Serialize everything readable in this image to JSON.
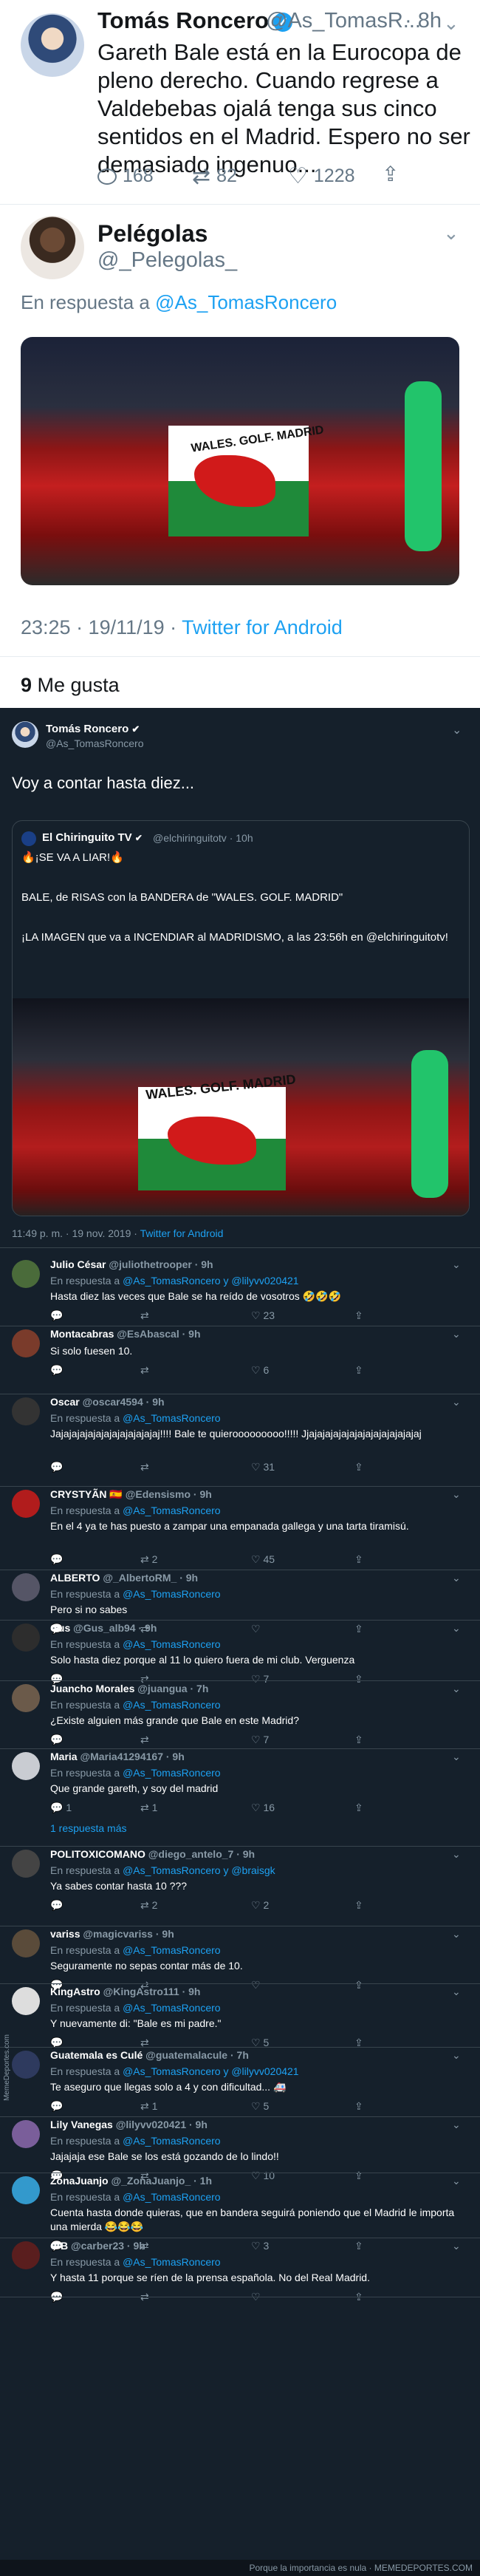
{
  "tweet1": {
    "name": "Tomás Roncero",
    "handle": "@As_TomasR...",
    "time": "· 8h",
    "text": "Gareth Bale está en la Eurocopa de pleno derecho. Cuando regrese a Valdebebas ojalá tenga sus cinco sentidos en el Madrid. Espero no ser demasiado ingenuo...",
    "replies": "168",
    "retweets": "82",
    "likes": "1228"
  },
  "tweet2": {
    "name": "Pelégolas",
    "handle": "@_Pelegolas_",
    "reply_prefix": "En respuesta a ",
    "reply_to": "@As_TomasRoncero",
    "photo_text": "WALES. GOLF. MADRID",
    "time": "23:25 · 19/11/19 · ",
    "source": "Twitter for Android",
    "likes_count": "9",
    "likes_label": " Me gusta"
  },
  "dark": {
    "main": {
      "name": "Tomás Roncero",
      "handle": "@As_TomasRoncero",
      "text": "Voy a contar hasta diez...",
      "quote": {
        "name": "El Chiringuito TV",
        "handle": "@elchiringuitotv · 10h",
        "line1": "🔥¡SE VA A LIAR!🔥",
        "line2": "BALE, de RISAS con la BANDERA de \"WALES. GOLF. MADRID\"",
        "line3": "¡LA IMAGEN que va a INCENDIAR al MADRIDISMO, a las 23:56h en @elchiringuitotv!",
        "photo_text": "WALES. GOLF. MADRID"
      },
      "meta": "11:49 p. m. · 19 nov. 2019 · ",
      "source": "Twitter for Android"
    },
    "replies": [
      {
        "name": "Julio César",
        "handle": "@juliothetrooper · 9h",
        "reply": "En respuesta a ",
        "reply_to": "@As_TomasRoncero y @lilyvv020421",
        "text": "Hasta diez las veces que Bale se ha reído de vosotros 🤣🤣🤣",
        "r": "",
        "rt": "",
        "l": "23"
      },
      {
        "name": "Montacabras",
        "handle": "@EsAbascal · 9h",
        "reply": "",
        "reply_to": "",
        "text": "Si solo fuesen 10.",
        "r": "",
        "rt": "",
        "l": "6"
      },
      {
        "name": "Oscar",
        "handle": "@oscar4594 · 9h",
        "reply": "En respuesta a ",
        "reply_to": "@As_TomasRoncero",
        "text": "Jajajajajajajajajajajajajaj!!!! Bale te quierooooooooo!!!!! Jjajajajajajajajajajajajajajaj",
        "r": "",
        "rt": "",
        "l": "31"
      },
      {
        "name": "CRYSTYÃN 🇪🇸",
        "handle": "@Edensismo · 9h",
        "reply": "En respuesta a ",
        "reply_to": "@As_TomasRoncero",
        "text": "En el 4 ya te has puesto a zampar una empanada gallega y una tarta tiramisú.",
        "r": "",
        "rt": "2",
        "l": "45"
      },
      {
        "name": "ALBERTO",
        "handle": "@_AlbertoRM_ · 9h",
        "reply": "En respuesta a ",
        "reply_to": "@As_TomasRoncero",
        "text": "Pero si no sabes",
        "r": "",
        "rt": "",
        "l": ""
      },
      {
        "name": "Gus",
        "handle": "@Gus_alb94 · 9h",
        "reply": "En respuesta a ",
        "reply_to": "@As_TomasRoncero",
        "text": "Solo hasta diez porque al 11 lo quiero fuera de mi club. Verguenza",
        "r": "",
        "rt": "",
        "l": "7"
      },
      {
        "name": "Juancho Morales",
        "handle": "@juangua · 7h",
        "reply": "En respuesta a ",
        "reply_to": "@As_TomasRoncero",
        "text": "¿Existe alguien más grande que Bale en este Madrid?",
        "r": "",
        "rt": "",
        "l": "7"
      },
      {
        "name": "Maria",
        "handle": "@Maria41294167 · 9h",
        "reply": "En respuesta a ",
        "reply_to": "@As_TomasRoncero",
        "text": "Que grande gareth, y soy del madrid",
        "r": "1",
        "rt": "1",
        "l": "16",
        "more": "1 respuesta más"
      },
      {
        "name": "POLITOXICOMANO",
        "handle": "@diego_antelo_7 · 9h",
        "reply": "En respuesta a ",
        "reply_to": "@As_TomasRoncero y @braisgk",
        "text": "Ya sabes contar hasta 10 ???",
        "r": "",
        "rt": "2",
        "l": "2"
      },
      {
        "name": "variss",
        "handle": "@magicvariss · 9h",
        "reply": "En respuesta a ",
        "reply_to": "@As_TomasRoncero",
        "text": "Seguramente no sepas contar más de 10.",
        "r": "",
        "rt": "",
        "l": ""
      },
      {
        "name": "KingAstro",
        "handle": "@KingAstro111 · 9h",
        "reply": "En respuesta a ",
        "reply_to": "@As_TomasRoncero",
        "text": "Y nuevamente di: \"Bale es mi padre.\"",
        "r": "",
        "rt": "",
        "l": "5"
      },
      {
        "name": "Guatemala es Culé",
        "handle": "@guatemalacule · 7h",
        "reply": "En respuesta a ",
        "reply_to": "@As_TomasRoncero y @lilyvv020421",
        "text": "Te aseguro que llegas solo a 4 y con dificultad... 🚑",
        "r": "",
        "rt": "1",
        "l": "5"
      },
      {
        "name": "Lily Vanegas",
        "handle": "@lilyvv020421 · 9h",
        "reply": "En respuesta a ",
        "reply_to": "@As_TomasRoncero",
        "text": "Jajajaja ese Bale se los está gozando de lo lindo!!",
        "r": "",
        "rt": "",
        "l": "10"
      },
      {
        "name": "ZonaJuanjo",
        "handle": "@_ZonaJuanjo_ · 1h",
        "reply": "En respuesta a ",
        "reply_to": "@As_TomasRoncero",
        "text": "Cuenta hasta donde quieras, que en bandera seguirá poniendo que el Madrid le importa una mierda 😂😂😂",
        "r": "",
        "rt": "",
        "l": "3"
      },
      {
        "name": "C B",
        "handle": "@carber23 · 9h",
        "reply": "En respuesta a ",
        "reply_to": "@As_TomasRoncero",
        "text": "Y hasta 11 porque se ríen de la prensa española. No del Real Madrid.",
        "r": "",
        "rt": "",
        "l": ""
      }
    ],
    "footer": "Porque la importancia es nula · MEMEDEPORTES.COM",
    "side": "MemeDeportes.com"
  }
}
